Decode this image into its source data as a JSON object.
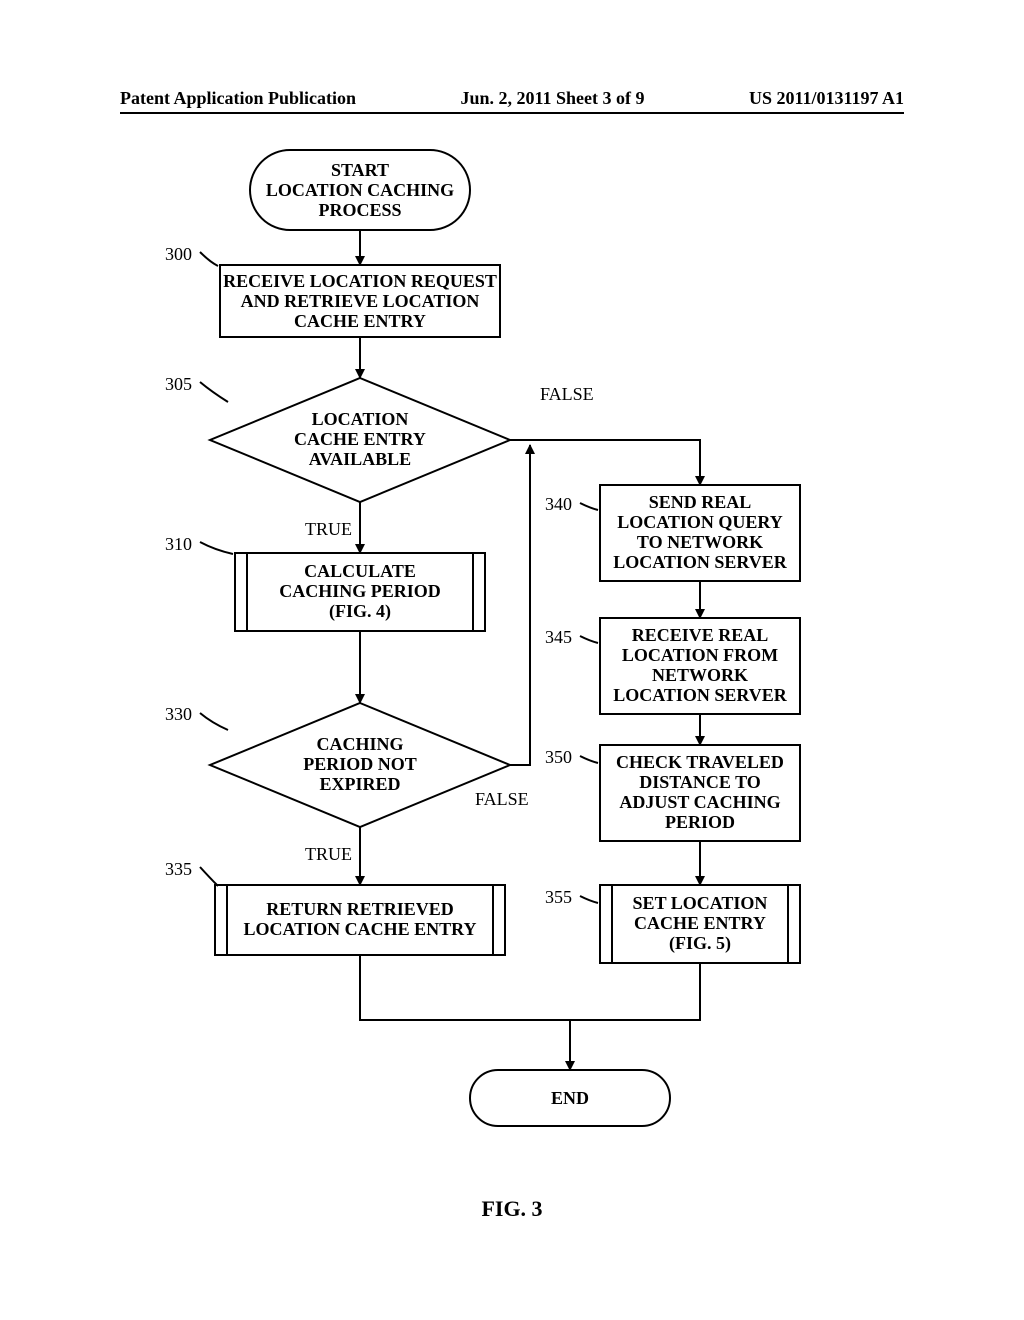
{
  "header": {
    "left": "Patent Application Publication",
    "center": "Jun. 2, 2011  Sheet 3 of 9",
    "right": "US 2011/0131197 A1"
  },
  "figure_label": "FIG. 3",
  "nodes": {
    "start": {
      "l1": "START",
      "l2": "LOCATION CACHING",
      "l3": "PROCESS"
    },
    "n300": {
      "l1": "RECEIVE LOCATION REQUEST",
      "l2": "AND RETRIEVE LOCATION",
      "l3": "CACHE ENTRY"
    },
    "n305": {
      "l1": "LOCATION",
      "l2": "CACHE ENTRY",
      "l3": "AVAILABLE"
    },
    "n310": {
      "l1": "CALCULATE",
      "l2": "CACHING PERIOD",
      "l3": "(FIG. 4)"
    },
    "n330": {
      "l1": "CACHING",
      "l2": "PERIOD NOT",
      "l3": "EXPIRED"
    },
    "n335": {
      "l1": "RETURN RETRIEVED",
      "l2": "LOCATION CACHE ENTRY"
    },
    "n340": {
      "l1": "SEND REAL",
      "l2": "LOCATION QUERY",
      "l3": "TO NETWORK",
      "l4": "LOCATION SERVER"
    },
    "n345": {
      "l1": "RECEIVE REAL",
      "l2": "LOCATION FROM",
      "l3": "NETWORK",
      "l4": "LOCATION SERVER"
    },
    "n350": {
      "l1": "CHECK TRAVELED",
      "l2": "DISTANCE TO",
      "l3": "ADJUST CACHING",
      "l4": "PERIOD"
    },
    "n355": {
      "l1": "SET LOCATION",
      "l2": "CACHE ENTRY",
      "l3": "(FIG. 5)"
    },
    "end": {
      "l1": "END"
    }
  },
  "refs": {
    "r300": "300",
    "r305": "305",
    "r310": "310",
    "r330": "330",
    "r335": "335",
    "r340": "340",
    "r345": "345",
    "r350": "350",
    "r355": "355"
  },
  "edges": {
    "true": "TRUE",
    "false": "FALSE"
  }
}
